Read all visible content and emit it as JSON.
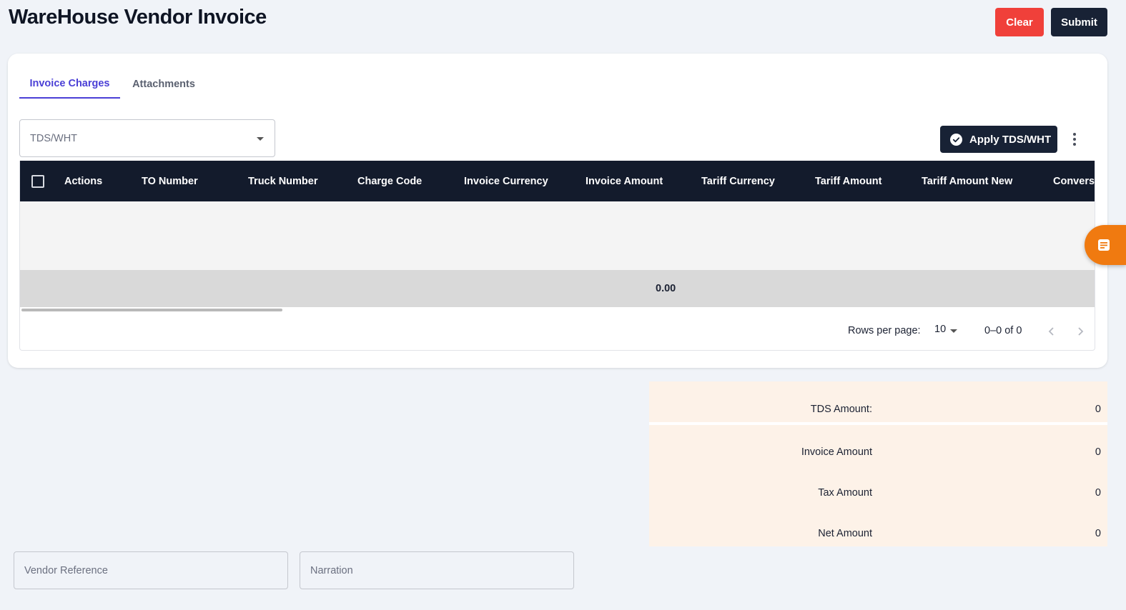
{
  "header": {
    "title": "WareHouse Vendor Invoice",
    "clear_label": "Clear",
    "submit_label": "Submit"
  },
  "tabs": [
    {
      "label": "Invoice Charges",
      "active": true
    },
    {
      "label": "Attachments",
      "active": false
    }
  ],
  "toolbar": {
    "tds_select_placeholder": "TDS/WHT",
    "apply_label": "Apply TDS/WHT",
    "more_icon": "more-vertical-icon"
  },
  "grid": {
    "columns": [
      "Actions",
      "TO Number",
      "Truck Number",
      "Charge Code",
      "Invoice Currency",
      "Invoice Amount",
      "Tariff Currency",
      "Tariff Amount",
      "Tariff Amount New",
      "Conversi"
    ],
    "rows": [],
    "total": "0.00"
  },
  "pagination": {
    "rows_per_page_label": "Rows per page:",
    "rows_per_page": "10",
    "range": "0–0 of 0"
  },
  "summary": [
    {
      "label": "TDS Amount:",
      "value": "0"
    },
    {
      "label": "Invoice Amount",
      "value": "0"
    },
    {
      "label": "Tax Amount",
      "value": "0"
    },
    {
      "label": "Net Amount",
      "value": "0"
    }
  ],
  "fields": {
    "vendor_reference_placeholder": "Vendor Reference",
    "narration_placeholder": "Narration"
  },
  "colors": {
    "clear": "#f0403a",
    "primary_dark": "#182235",
    "accent": "#4a3fd6",
    "fab": "#f07a10",
    "summary_bg": "#fdf2e8"
  }
}
